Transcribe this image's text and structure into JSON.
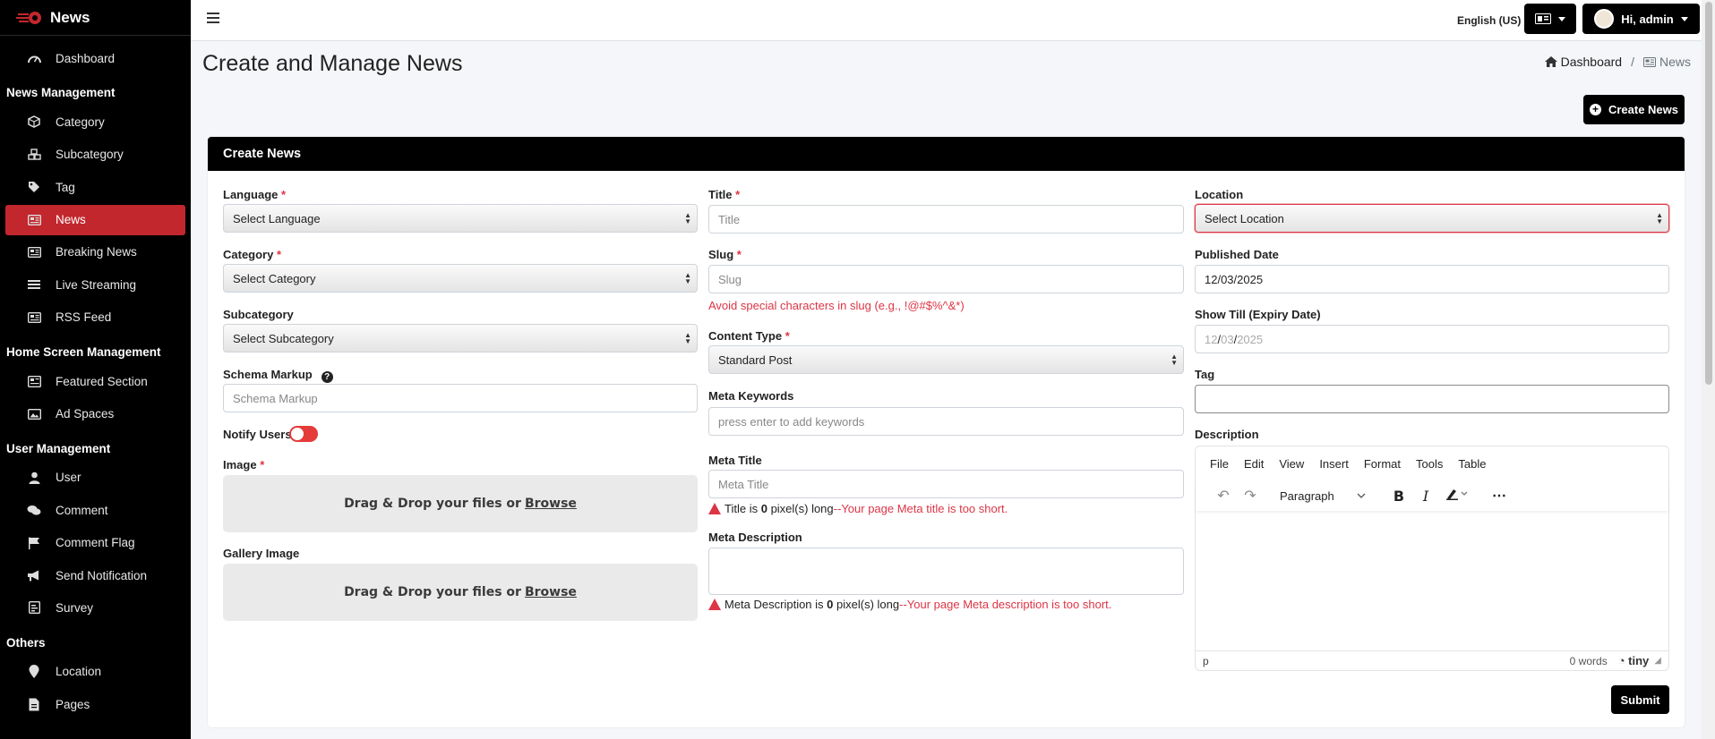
{
  "app": {
    "brand": "News"
  },
  "sidebar": {
    "groups": [
      {
        "header": "",
        "items": [
          {
            "label": "Dashboard",
            "icon": "dashboard-icon"
          }
        ]
      },
      {
        "header": "News Management",
        "items": [
          {
            "label": "Category",
            "icon": "cube-icon"
          },
          {
            "label": "Subcategory",
            "icon": "cubes-icon"
          },
          {
            "label": "Tag",
            "icon": "tag-icon"
          },
          {
            "label": "News",
            "icon": "newspaper-icon",
            "active": true
          },
          {
            "label": "Breaking News",
            "icon": "newspaper-icon"
          },
          {
            "label": "Live Streaming",
            "icon": "list-icon"
          },
          {
            "label": "RSS Feed",
            "icon": "newspaper-icon"
          }
        ]
      },
      {
        "header": "Home Screen Management",
        "items": [
          {
            "label": "Featured Section",
            "icon": "layers-icon"
          },
          {
            "label": "Ad Spaces",
            "icon": "image-icon"
          }
        ]
      },
      {
        "header": "User Management",
        "items": [
          {
            "label": "User",
            "icon": "user-icon"
          },
          {
            "label": "Comment",
            "icon": "comments-icon"
          },
          {
            "label": "Comment Flag",
            "icon": "flag-icon"
          },
          {
            "label": "Send Notification",
            "icon": "bullhorn-icon"
          },
          {
            "label": "Survey",
            "icon": "poll-icon"
          }
        ]
      },
      {
        "header": "Others",
        "items": [
          {
            "label": "Location",
            "icon": "map-pin-icon"
          },
          {
            "label": "Pages",
            "icon": "file-icon"
          }
        ]
      }
    ]
  },
  "topbar": {
    "language": "English (US)",
    "user_greeting": "Hi, admin"
  },
  "page": {
    "title": "Create and Manage News",
    "breadcrumb": {
      "home": "Dashboard",
      "current": "News",
      "separator": "/"
    },
    "create_button": "Create News"
  },
  "form": {
    "card_title": "Create News",
    "required_mark": "*",
    "language": {
      "label": "Language",
      "value": "Select Language"
    },
    "category": {
      "label": "Category",
      "value": "Select Category"
    },
    "subcategory": {
      "label": "Subcategory",
      "value": "Select Subcategory"
    },
    "schema": {
      "label": "Schema Markup",
      "placeholder": "Schema Markup"
    },
    "notify": {
      "label": "Notify Users"
    },
    "image": {
      "label": "Image",
      "drop_text": "Drag & Drop your files or",
      "browse": "Browse"
    },
    "gallery": {
      "label": "Gallery Image",
      "drop_text": "Drag & Drop your files or",
      "browse": "Browse"
    },
    "title": {
      "label": "Title",
      "placeholder": "Title"
    },
    "slug": {
      "label": "Slug",
      "placeholder": "Slug",
      "hint": "Avoid special characters in slug (e.g., !@#$%^&*)"
    },
    "content_type": {
      "label": "Content Type",
      "value": "Standard Post"
    },
    "meta_keywords": {
      "label": "Meta Keywords",
      "placeholder": "press enter to add keywords"
    },
    "meta_title": {
      "label": "Meta Title",
      "placeholder": "Meta Title",
      "warn_prefix": "Title is",
      "warn_count": "0",
      "warn_unit": "pixel(s) long",
      "warn_red": "--Your page Meta title is too short."
    },
    "meta_description": {
      "label": "Meta Description",
      "warn_prefix": "Meta Description is",
      "warn_count": "0",
      "warn_unit": "pixel(s) long",
      "warn_red": "--Your page Meta description is too short."
    },
    "location": {
      "label": "Location",
      "value": "Select Location"
    },
    "published_date": {
      "label": "Published Date",
      "value": "12/03/2025"
    },
    "show_till": {
      "label": "Show Till (Expiry Date)",
      "mm": "12",
      "dd": "03",
      "yyyy": "2025"
    },
    "tag": {
      "label": "Tag"
    },
    "description": {
      "label": "Description"
    },
    "submit": "Submit"
  },
  "editor": {
    "menu": [
      "File",
      "Edit",
      "View",
      "Insert",
      "Format",
      "Tools",
      "Table"
    ],
    "block_format": "Paragraph",
    "status_path": "p",
    "word_count": "0 words",
    "brand": "tiny"
  },
  "colors": {
    "accent": "#c1272d",
    "danger": "#dc3545",
    "sidebar_bg": "#000000"
  }
}
